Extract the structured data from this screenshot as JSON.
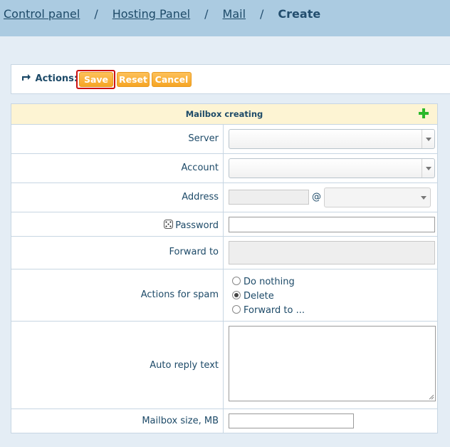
{
  "breadcrumb": {
    "items": [
      "Control panel",
      "Hosting Panel",
      "Mail"
    ],
    "separator": "/",
    "current": "Create"
  },
  "actions": {
    "label": "Actions:",
    "save": "Save",
    "reset": "Reset",
    "cancel": "Cancel"
  },
  "form": {
    "title": "Mailbox creating",
    "fields": {
      "server": "Server",
      "account": "Account",
      "address": "Address",
      "at": "@",
      "password": "Password",
      "forward_to": "Forward to",
      "actions_for_spam": "Actions for spam",
      "auto_reply_text": "Auto reply text",
      "mailbox_size": "Mailbox size, MB"
    },
    "spam_options": [
      "Do nothing",
      "Delete",
      "Forward to ..."
    ],
    "spam_selected": "Delete"
  },
  "colors": {
    "header": "#abcbe1",
    "background": "#e4edf5",
    "button": "#f6a524",
    "form_header": "#fdf4d3",
    "highlight": "#cc1111"
  },
  "icons": [
    "return-arrow-icon",
    "plus-icon",
    "dice-icon",
    "chevron-down-icon"
  ]
}
